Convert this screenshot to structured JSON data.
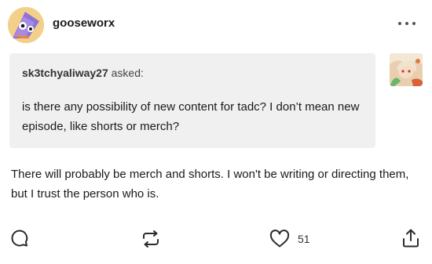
{
  "post": {
    "username": "gooseworx",
    "asker": {
      "name": "sk3tchyaliway27",
      "suffix": " asked:"
    },
    "question": "is there any possibility of new content for tadc? I don’t mean new episode, like shorts or merch?",
    "answer": "There will probably be merch and shorts. I won't be writing or directing them, but I trust the person who is.",
    "like_count": "51"
  },
  "icons": {
    "more": "more-options-icon",
    "reply": "reply-icon",
    "reblog": "reblog-icon",
    "like": "heart-icon",
    "share": "share-icon"
  }
}
